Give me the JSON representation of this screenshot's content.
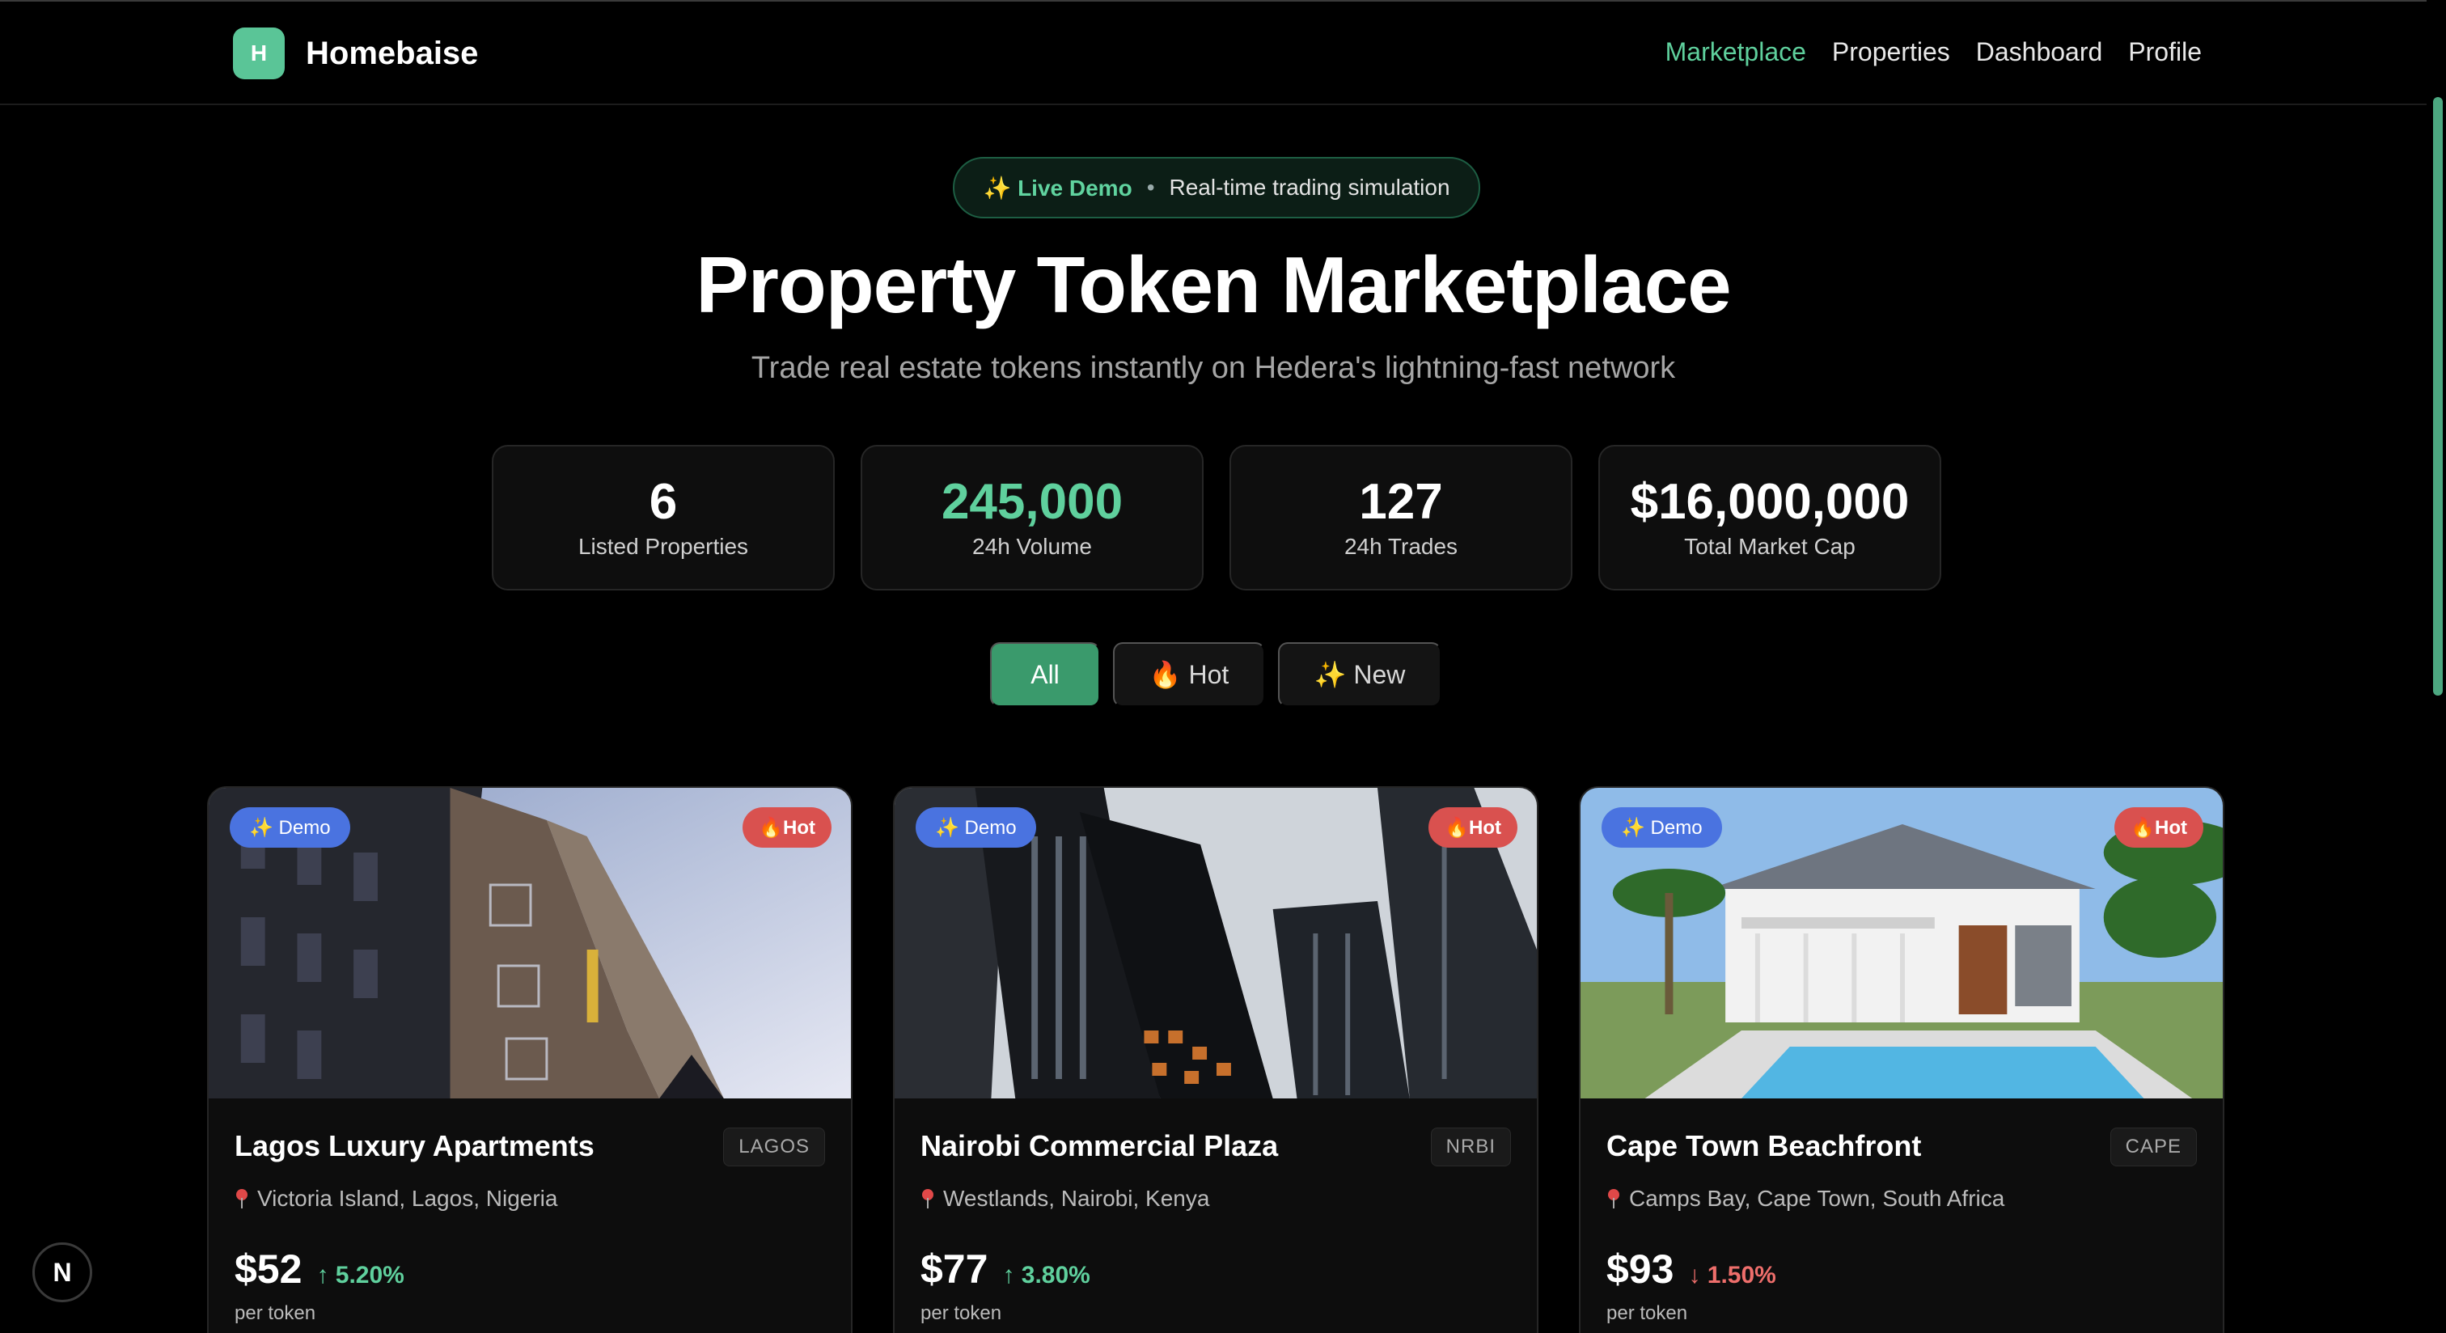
{
  "brand": {
    "logo_letter": "H",
    "name": "Homebaise"
  },
  "nav": {
    "items": [
      {
        "label": "Marketplace",
        "active": true
      },
      {
        "label": "Properties",
        "active": false
      },
      {
        "label": "Dashboard",
        "active": false
      },
      {
        "label": "Profile",
        "active": false
      }
    ]
  },
  "hero": {
    "badge_live": "✨ Live Demo",
    "badge_separator": "•",
    "badge_text": "Real-time trading simulation",
    "title": "Property Token Marketplace",
    "subtitle": "Trade real estate tokens instantly on Hedera's lightning-fast network"
  },
  "stats": [
    {
      "value": "6",
      "label": "Listed Properties"
    },
    {
      "value": "245,000",
      "label": "24h Volume"
    },
    {
      "value": "127",
      "label": "24h Trades"
    },
    {
      "value": "$16,000,000",
      "label": "Total Market Cap"
    }
  ],
  "filters": [
    {
      "label": "All",
      "active": true
    },
    {
      "label": "🔥 Hot",
      "active": false
    },
    {
      "label": "✨ New",
      "active": false
    }
  ],
  "cards": [
    {
      "badge_demo": "✨ Demo",
      "badge_hot": "🔥Hot",
      "title": "Lagos Luxury Apartments",
      "code": "LAGOS",
      "location": "Victoria Island, Lagos, Nigeria",
      "price": "$52",
      "change": "↑ 5.20%",
      "change_dir": "up",
      "per_token": "per token"
    },
    {
      "badge_demo": "✨ Demo",
      "badge_hot": "🔥Hot",
      "title": "Nairobi Commercial Plaza",
      "code": "NRBI",
      "location": "Westlands, Nairobi, Kenya",
      "price": "$77",
      "change": "↑ 3.80%",
      "change_dir": "up",
      "per_token": "per token"
    },
    {
      "badge_demo": "✨ Demo",
      "badge_hot": "🔥Hot",
      "title": "Cape Town Beachfront",
      "code": "CAPE",
      "location": "Camps Bay, Cape Town, South Africa",
      "price": "$93",
      "change": "↓ 1.50%",
      "change_dir": "down",
      "per_token": "per token"
    }
  ],
  "floating_badge": "N",
  "colors": {
    "accent": "#5fd09d",
    "demo_badge": "#4a73e0",
    "hot_badge": "#d9514f",
    "down": "#ee6e6b"
  }
}
